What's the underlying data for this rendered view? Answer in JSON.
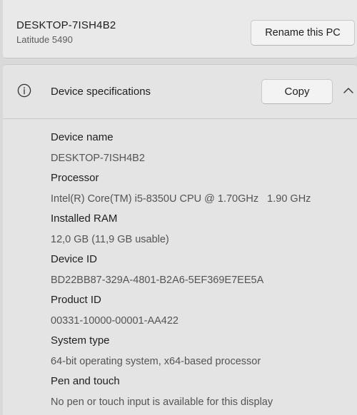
{
  "pc": {
    "name": "DESKTOP-7ISH4B2",
    "model": "Latitude 5490",
    "rename_label": "Rename this PC"
  },
  "device_specs": {
    "title": "Device specifications",
    "copy_label": "Copy",
    "icons": {
      "header": "info-icon",
      "toggle": "chevron-up-icon"
    },
    "items": [
      {
        "label": "Device name",
        "value": "DESKTOP-7ISH4B2"
      },
      {
        "label": "Processor",
        "value": "Intel(R) Core(TM) i5-8350U CPU @ 1.70GHz   1.90 GHz"
      },
      {
        "label": "Installed RAM",
        "value": "12,0 GB (11,9 GB usable)"
      },
      {
        "label": "Device ID",
        "value": "BD22BB87-329A-4801-B2A6-5EF369E7EE5A"
      },
      {
        "label": "Product ID",
        "value": "00331-10000-00001-AA422"
      },
      {
        "label": "System type",
        "value": "64-bit operating system, x64-based processor"
      },
      {
        "label": "Pen and touch",
        "value": "No pen or touch input is available for this display"
      }
    ]
  }
}
